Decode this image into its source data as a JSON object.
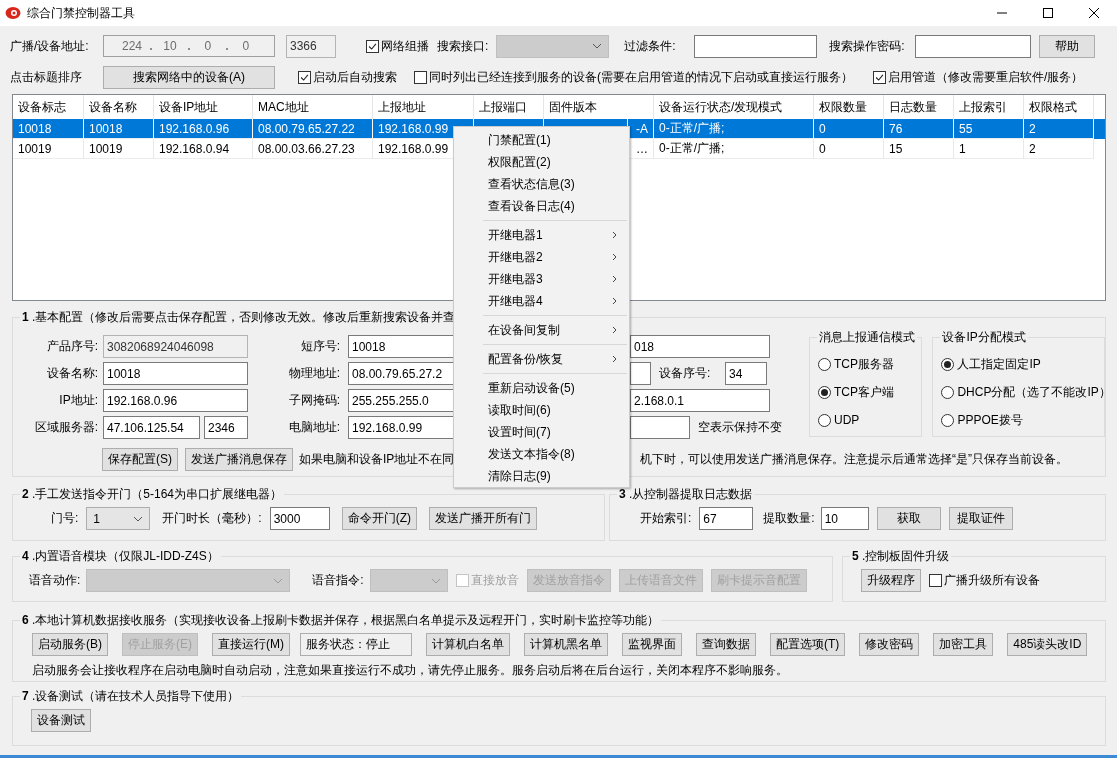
{
  "window": {
    "title": "综合门禁控制器工具"
  },
  "search_bar": {
    "address_label": "广播/设备地址:",
    "ip_octets": [
      "224",
      "10",
      "0",
      "0"
    ],
    "port": "3366",
    "multicast": {
      "label": "网络组播",
      "checked": true
    },
    "interface_label": "搜索接口:",
    "filter_label": "过滤条件:",
    "password_label": "搜索操作密码:",
    "help_button": "帮助",
    "sort_hint": "点击标题排序",
    "search_button": "搜索网络中的设备(A)",
    "options": [
      {
        "label": "启动后自动搜索",
        "checked": true
      },
      {
        "label": "同时列出已经连接到服务的设备(需要在启用管道的情况下启动或直接运行服务）",
        "checked": false
      },
      {
        "label": "启用管道（修改需要重启软件/服务）",
        "checked": true
      }
    ]
  },
  "device_table": {
    "columns": [
      "设备标志",
      "设备名称",
      "设备IP地址",
      "MAC地址",
      "上报地址",
      "上报端口",
      "固件版本",
      "设备运行状态/发现模式",
      "权限数量",
      "日志数量",
      "上报索引",
      "权限格式"
    ],
    "rows": [
      {
        "selected": true,
        "cells": [
          "10018",
          "10018",
          "192.168.0.96",
          "08.00.79.65.27.22",
          "192.168.0.99",
          null,
          "-A",
          "0-正常/广播;",
          "0",
          "76",
          "55",
          "2"
        ]
      },
      {
        "selected": false,
        "cells": [
          "10019",
          "10019",
          "192.168.0.94",
          "08.00.03.66.27.23",
          "192.168.0.99",
          null,
          "…",
          "0-正常/广播;",
          "0",
          "15",
          "1",
          "2"
        ]
      }
    ]
  },
  "basic_config": {
    "title": "**1** .基本配置（修改后需要点击保存配置，否则修改无效。修改后重新搜索设备并查",
    "product_serial": {
      "label": "产品序号:",
      "value": "3082068924046098",
      "readonly": true
    },
    "device_name": {
      "label": "设备名称:",
      "value": "10018",
      "readonly": false
    },
    "ip_address": {
      "label": "IP地址:",
      "value": "192.168.0.96",
      "readonly": false
    },
    "area_server": {
      "label": "区域服务器:",
      "value": "47.106.125.54",
      "port": "2346"
    },
    "short_serial": {
      "label": "短序号:",
      "value": "10018"
    },
    "mac_address": {
      "label": "物理地址:",
      "value": "08.00.79.65.27.2"
    },
    "subnet_mask": {
      "label": "子网掩码:",
      "value": "255.255.255.0"
    },
    "pc_address": {
      "label": "电脑地址:",
      "value": "192.168.0.99"
    },
    "column_3": {
      "field_1": "018",
      "device_number_label": "设备序号:",
      "device_number": "34",
      "field_3": "2.168.0.1",
      "field_4_hint": "空表示保持不变"
    },
    "buttons": [
      {
        "label": "保存配置(S)",
        "disabled": false
      },
      {
        "label": "发送广播消息保存",
        "disabled": false
      }
    ],
    "note_left": "如果电脑和设备IP地址不在同",
    "note_right": "机下时，可以使用发送广播消息保存。注意提示后通常选择“是”只保存当前设备。",
    "report_mode": {
      "title": "消息上报通信模式",
      "options": [
        {
          "label": "TCP服务器",
          "selected": false
        },
        {
          "label": "TCP客户端",
          "selected": true
        },
        {
          "label": "UDP",
          "selected": false
        }
      ]
    },
    "ip_mode": {
      "title": "设备IP分配模式",
      "options": [
        {
          "label": "人工指定固定IP",
          "selected": true
        },
        {
          "label": "DHCP分配（选了不能改IP）",
          "selected": false
        },
        {
          "label": "PPPOE拨号",
          "selected": false
        }
      ]
    }
  },
  "manual_open": {
    "title": "**2** .手工发送指令开门（5-164为串口扩展继电器）",
    "door_label": "门号:",
    "door": "1",
    "duration_label": "开门时长（毫秒）:",
    "duration": "3000",
    "buttons": [
      {
        "label": "命令开门(Z)",
        "disabled": false
      },
      {
        "label": "发送广播开所有门",
        "disabled": false
      }
    ]
  },
  "log_fetch": {
    "title": "**3** .从控制器提取日志数据",
    "start_label": "开始索引:",
    "start": "67",
    "count_label": "提取数量:",
    "count": "10",
    "buttons": [
      {
        "label": "获取",
        "disabled": false
      },
      {
        "label": "提取证件",
        "disabled": false
      }
    ]
  },
  "voice": {
    "title": "**4** .内置语音模块（仅限JL-IDD-Z4S）",
    "action": {
      "label": "语音动作:",
      "disabled": true
    },
    "command": {
      "label": "语音指令:",
      "disabled": true
    },
    "direct_play": {
      "label": "直接放音",
      "checked": false,
      "disabled": true
    },
    "buttons": [
      {
        "label": "发送放音指令",
        "disabled": true
      },
      {
        "label": "上传语音文件",
        "disabled": true
      },
      {
        "label": "刷卡提示音配置",
        "disabled": true
      }
    ]
  },
  "firmware": {
    "title": "**5** .控制板固件升级",
    "button": {
      "label": "升级程序",
      "disabled": false
    },
    "broadcast": {
      "label": "广播升级所有设备",
      "checked": false,
      "disabled": false
    }
  },
  "service": {
    "title": "**6** .本地计算机数据接收服务（实现接收设备上报刷卡数据并保存，根据黑白名单提示及远程开门，实时刷卡监控等功能）",
    "buttons_before": [
      {
        "label": "启动服务(B)",
        "disabled": false
      },
      {
        "label": "停止服务(E)",
        "disabled": true
      },
      {
        "label": "直接运行(M)",
        "disabled": false
      }
    ],
    "status": "服务状态：停止",
    "buttons_after": [
      {
        "label": "计算机白名单",
        "disabled": false
      },
      {
        "label": "计算机黑名单",
        "disabled": false
      },
      {
        "label": "监视界面",
        "disabled": false
      },
      {
        "label": "查询数据",
        "disabled": false
      },
      {
        "label": "配置选项(T)",
        "disabled": false
      },
      {
        "label": "修改密码",
        "disabled": false
      },
      {
        "label": "加密工具",
        "disabled": false
      },
      {
        "label": "485读头改ID",
        "disabled": false
      }
    ],
    "note": "启动服务会让接收程序在启动电脑时自动启动，注意如果直接运行不成功，请先停止服务。服务启动后将在后台运行，关闭本程序不影响服务。"
  },
  "device_test": {
    "title": "**7** .设备测试（请在技术人员指导下使用）",
    "button": {
      "label": "设备测试",
      "disabled": false
    }
  },
  "context_menu": {
    "groups": [
      [
        {
          "label": "门禁配置(1)",
          "submenu": false
        },
        {
          "label": "权限配置(2)",
          "submenu": false
        },
        {
          "label": "查看状态信息(3)",
          "submenu": false
        },
        {
          "label": "查看设备日志(4)",
          "submenu": false
        }
      ],
      [
        {
          "label": "开继电器1",
          "submenu": true
        },
        {
          "label": "开继电器2",
          "submenu": true
        },
        {
          "label": "开继电器3",
          "submenu": true
        },
        {
          "label": "开继电器4",
          "submenu": true
        }
      ],
      [
        {
          "label": "在设备间复制",
          "submenu": true
        }
      ],
      [
        {
          "label": "配置备份/恢复",
          "submenu": true
        }
      ],
      [
        {
          "label": "重新启动设备(5)",
          "submenu": false
        },
        {
          "label": "读取时间(6)",
          "submenu": false
        },
        {
          "label": "设置时间(7)",
          "submenu": false
        },
        {
          "label": "发送文本指令(8)",
          "submenu": false
        },
        {
          "label": "清除日志(9)",
          "submenu": false
        }
      ]
    ]
  }
}
